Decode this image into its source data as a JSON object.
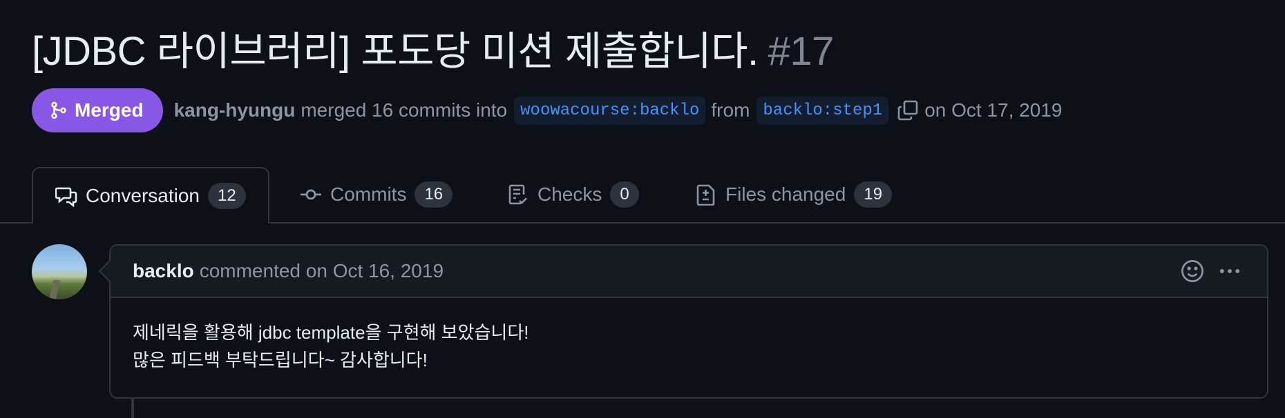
{
  "pr": {
    "title": "[JDBC 라이브러리] 포도당 미션 제출합니다.",
    "number": "#17",
    "status": "Merged",
    "author": "kang-hyungu",
    "merged_text": "merged 16 commits into",
    "base_branch": "woowacourse:backlo",
    "from_text": "from",
    "head_branch": "backlo:step1",
    "date_text": "on Oct 17, 2019"
  },
  "tabs": [
    {
      "label": "Conversation",
      "count": "12",
      "icon": "comment-discussion-icon"
    },
    {
      "label": "Commits",
      "count": "16",
      "icon": "git-commit-icon"
    },
    {
      "label": "Checks",
      "count": "0",
      "icon": "checklist-icon"
    },
    {
      "label": "Files changed",
      "count": "19",
      "icon": "file-diff-icon"
    }
  ],
  "comment": {
    "author": "backlo",
    "meta": "commented on Oct 16, 2019",
    "body_lines": [
      "제네릭을 활용해 jdbc template을 구현해 보았습니다!",
      "많은 피드백 부탁드립니다~ 감사합니다!"
    ]
  },
  "colors": {
    "background": "#0d1117",
    "merged_badge": "#8957e5",
    "branch_text": "#4493f8",
    "border": "#30363d"
  }
}
